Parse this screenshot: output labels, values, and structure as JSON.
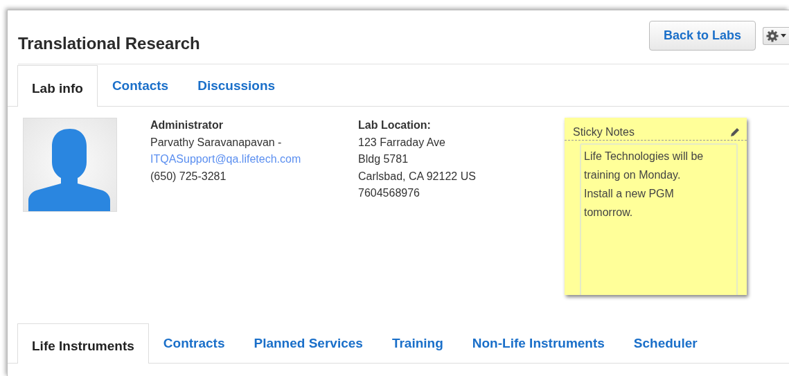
{
  "header": {
    "title": "Translational Research",
    "back_button": "Back to Labs"
  },
  "tabs": [
    {
      "label": "Lab info",
      "selected": true
    },
    {
      "label": "Contacts",
      "selected": false
    },
    {
      "label": "Discussions",
      "selected": false
    }
  ],
  "administrator": {
    "heading": "Administrator",
    "name": "Parvathy Saravanapavan -",
    "email": "ITQASupport@qa.lifetech.com",
    "phone": "(650) 725-3281"
  },
  "location": {
    "heading": "Lab Location:",
    "lines": [
      "123 Farraday Ave",
      "Bldg 5781",
      "Carlsbad, CA 92122 US",
      "7604568976"
    ]
  },
  "sticky_note": {
    "title": "Sticky Notes",
    "lines": [
      "Life Technologies will be",
      "training on Monday.",
      "Install a new PGM",
      "tomorrow."
    ]
  },
  "bottom_tabs": [
    {
      "label": "Life Instruments",
      "selected": true
    },
    {
      "label": "Contracts",
      "selected": false
    },
    {
      "label": "Planned Services",
      "selected": false
    },
    {
      "label": "Training",
      "selected": false
    },
    {
      "label": "Non-Life Instruments",
      "selected": false
    },
    {
      "label": "Scheduler",
      "selected": false
    }
  ]
}
